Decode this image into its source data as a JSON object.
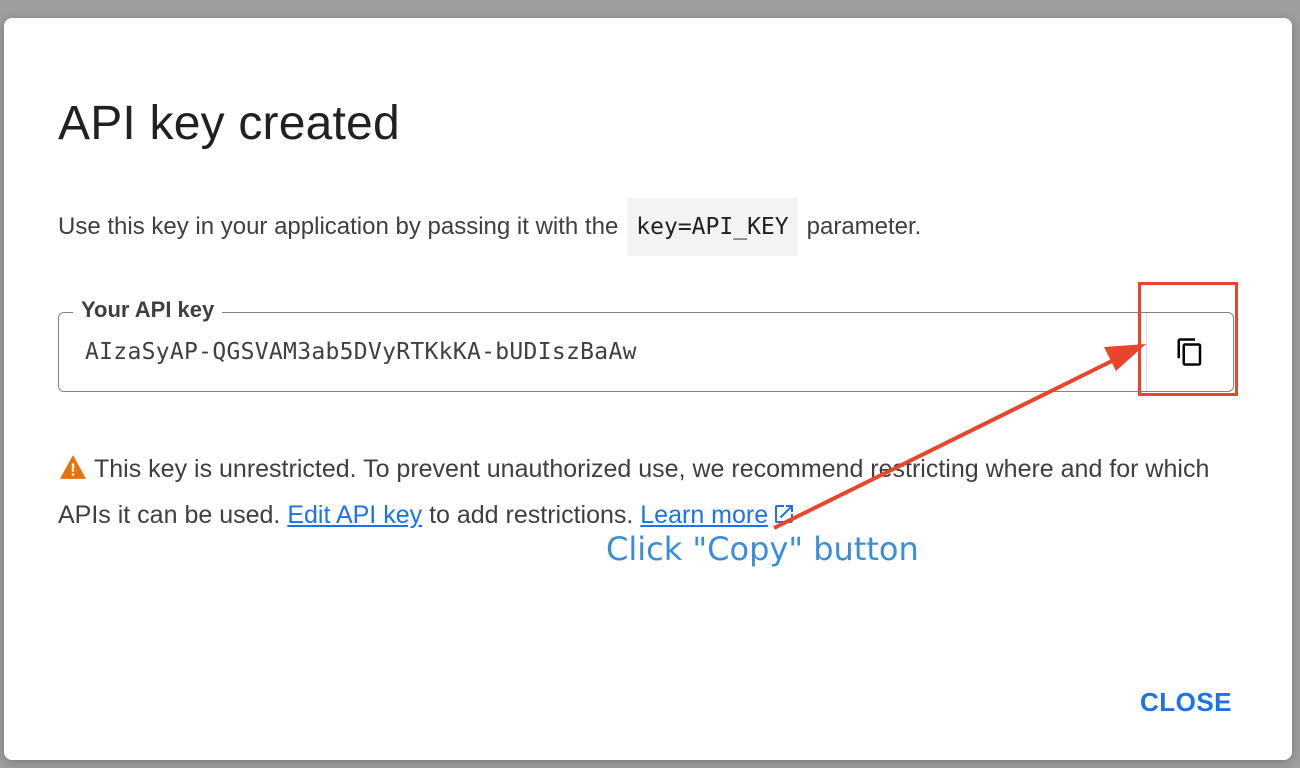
{
  "dialog": {
    "title": "API key created",
    "description_before": "Use this key in your application by passing it with the",
    "description_code": "key=API_KEY",
    "description_after": "parameter.",
    "key_field": {
      "label": "Your API key",
      "value": "AIzaSyAP-QGSVAM3ab5DVyRTKkKA-bUDIszBaAw",
      "copy_icon": "copy-icon"
    },
    "warning": {
      "icon": "warning-icon",
      "icon_color": "#e8710a",
      "text_before": "This key is unrestricted. To prevent unauthorized use, we recommend restricting where and for which APIs it can be used.",
      "edit_link": "Edit API key",
      "text_middle": "to add restrictions.",
      "learn_more_link": "Learn more",
      "external_icon": "open-in-new-icon"
    },
    "close_label": "CLOSE"
  },
  "annotation": {
    "callout_text": "Click \"Copy\" button",
    "highlight_color": "#e8452c",
    "callout_color": "#3a8ed8"
  },
  "colors": {
    "link": "#1a73e8",
    "text": "#3c4043"
  }
}
